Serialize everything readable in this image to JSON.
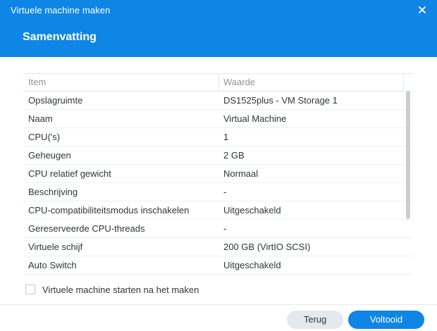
{
  "window": {
    "title": "Virtuele machine maken",
    "close_icon": "close-icon"
  },
  "page": {
    "title": "Samenvatting"
  },
  "table": {
    "columns": [
      "Item",
      "Waarde"
    ],
    "rows": [
      {
        "item": "Opslagruimte",
        "value": "DS1525plus - VM Storage 1"
      },
      {
        "item": "Naam",
        "value": "Virtual Machine"
      },
      {
        "item": "CPU('s)",
        "value": "1"
      },
      {
        "item": "Geheugen",
        "value": "2 GB"
      },
      {
        "item": "CPU relatief gewicht",
        "value": "Normaal"
      },
      {
        "item": "Beschrijving",
        "value": "-"
      },
      {
        "item": "CPU-compatibiliteitsmodus inschakelen",
        "value": "Uitgeschakeld"
      },
      {
        "item": "Gereserveerde CPU-threads",
        "value": "-"
      },
      {
        "item": "Virtuele schijf",
        "value": "200 GB (VirtIO SCSI)"
      },
      {
        "item": "Auto Switch",
        "value": "Uitgeschakeld"
      }
    ]
  },
  "options": {
    "start_after_create_label": "Virtuele machine starten na het maken",
    "start_after_create_checked": false
  },
  "buttons": {
    "back_label": "Terug",
    "finish_label": "Voltooid"
  },
  "colors": {
    "accent": "#0f86e6",
    "secondary_button": "#e4e9ef"
  }
}
